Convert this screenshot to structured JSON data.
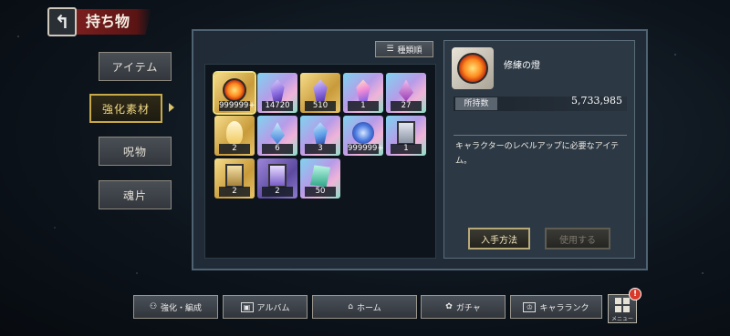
{
  "header": {
    "back_icon": "back-arrow-icon",
    "title": "持ち物"
  },
  "tabs": [
    {
      "label": "アイテム",
      "active": false
    },
    {
      "label": "強化素材",
      "active": true
    },
    {
      "label": "呪物",
      "active": false
    },
    {
      "label": "魂片",
      "active": false
    }
  ],
  "sort": {
    "label": "種類順",
    "icon": "sort-icon"
  },
  "items": [
    {
      "icon": "flame-orb-icon",
      "rarity": "gold",
      "count": "999999+",
      "selected": true
    },
    {
      "icon": "purple-crystal-icon",
      "rarity": "rainbow",
      "count": "14720"
    },
    {
      "icon": "purple-crystal-icon",
      "rarity": "gold",
      "count": "510"
    },
    {
      "icon": "rainbow-crystal-icon",
      "rarity": "rainbow",
      "count": "1"
    },
    {
      "icon": "pink-shard-icon",
      "rarity": "rainbow",
      "count": "27"
    },
    {
      "icon": "feather-icon",
      "rarity": "gold",
      "count": "2"
    },
    {
      "icon": "blue-shard-icon",
      "rarity": "rainbow",
      "count": "6"
    },
    {
      "icon": "blue-crystal-icon",
      "rarity": "rainbow",
      "count": "3"
    },
    {
      "icon": "blue-orb-icon",
      "rarity": "rainbow",
      "count": "999999+"
    },
    {
      "icon": "card-icon",
      "rarity": "rainbow",
      "count": "1"
    },
    {
      "icon": "card-icon",
      "rarity": "gold",
      "count": "2"
    },
    {
      "icon": "card-icon",
      "rarity": "purple",
      "count": "2"
    },
    {
      "icon": "tablet-icon",
      "rarity": "rainbow",
      "count": "50"
    }
  ],
  "detail": {
    "name": "修練の燈",
    "owned_label": "所持数",
    "owned_value": "5,733,985",
    "description": "キャラクターのレベルアップに必要なアイテム。",
    "obtain_label": "入手方法",
    "use_label": "使用する"
  },
  "bottom_nav": [
    {
      "label": "強化・編成",
      "icon": "team-icon"
    },
    {
      "label": "アルバム",
      "icon": "album-icon"
    },
    {
      "label": "ホーム",
      "icon": "home-icon"
    },
    {
      "label": "ガチャ",
      "icon": "gacha-icon"
    },
    {
      "label": "キャラランク",
      "icon": "rank-icon"
    }
  ],
  "menu": {
    "label": "メニュー",
    "badge": "!"
  },
  "colors": {
    "accent_gold": "#c8a94a",
    "panel": "#222e3a",
    "title_red": "#7a1e1e",
    "badge_red": "#d83a2a"
  }
}
